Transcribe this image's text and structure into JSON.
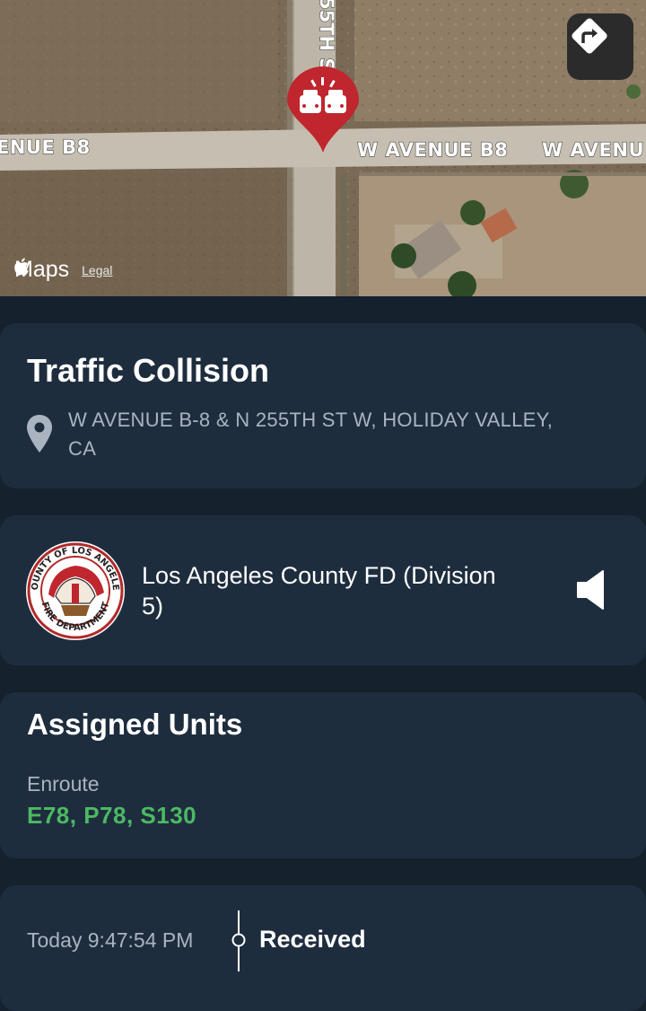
{
  "map": {
    "road_label_left": "ENUE B8",
    "road_label_center": "W AVENUE B8",
    "road_label_right": "W AVENU",
    "road_label_vertical": "55TH S",
    "brand": "Maps",
    "legal": "Legal",
    "pin_icon": "car-collision-icon",
    "directions_icon": "directions-icon"
  },
  "incident": {
    "title": "Traffic Collision",
    "location": "W AVENUE B-8 & N 255TH ST W, HOLIDAY VALLEY, CA",
    "location_icon": "location-pin-icon"
  },
  "agency": {
    "name": "Los Angeles County FD (Division 5)",
    "logo_text_top": "COUNTY OF LOS ANGELES",
    "logo_text_bottom": "FIRE DEPARTMENT",
    "audio_icon": "speaker-icon"
  },
  "units": {
    "title": "Assigned Units",
    "status": "Enroute",
    "list": "E78, P78, S130"
  },
  "timeline": {
    "time": "Today 9:47:54 PM",
    "event": "Received"
  },
  "colors": {
    "background": "#15212d",
    "card": "#1e2d3e",
    "accent_green": "#4cb963",
    "pin_red": "#c0262d",
    "muted_text": "#a9b4c0"
  }
}
